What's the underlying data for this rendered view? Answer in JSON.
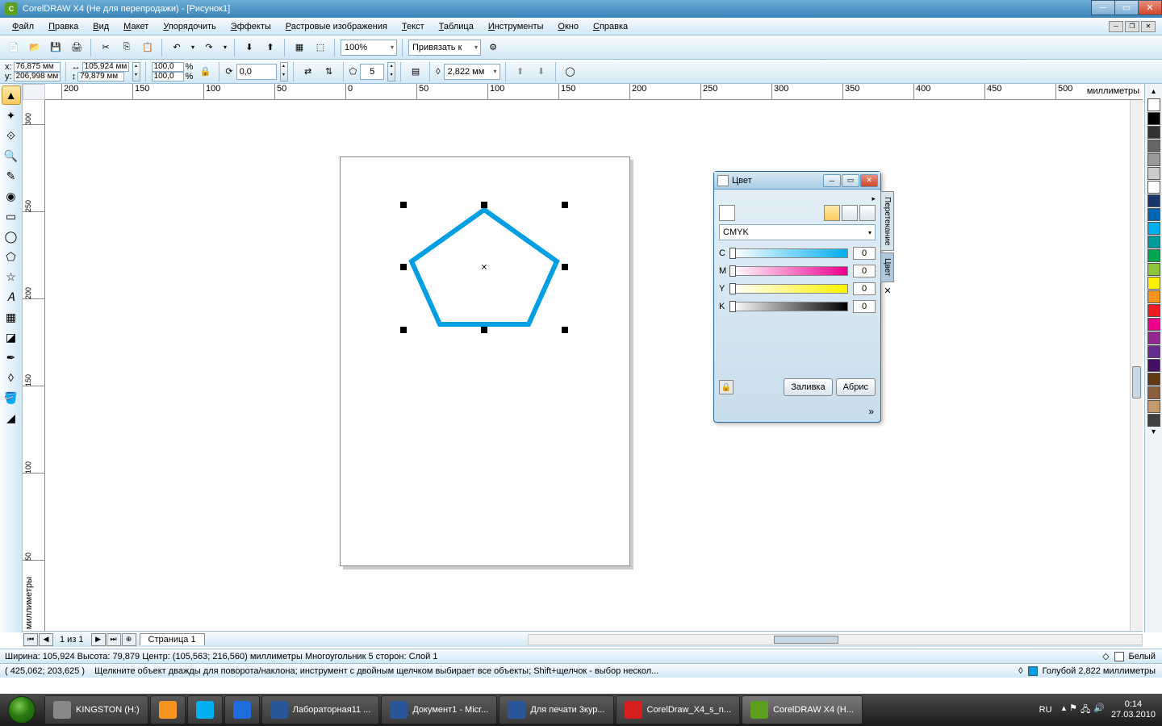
{
  "window": {
    "title": "CorelDRAW X4 (Не для перепродажи) - [Рисунок1]"
  },
  "menu": [
    "Файл",
    "Правка",
    "Вид",
    "Макет",
    "Упорядочить",
    "Эффекты",
    "Растровые изображения",
    "Текст",
    "Таблица",
    "Инструменты",
    "Окно",
    "Справка"
  ],
  "toolbar1": {
    "zoom": "100%",
    "snap_label": "Привязать к"
  },
  "propbar": {
    "x_label": "x:",
    "x": "76,875 мм",
    "y_label": "y:",
    "y": "206,998 мм",
    "w": "105,924 мм",
    "h": "79,879 мм",
    "sx": "100,0",
    "sy": "100,0",
    "pct": "%",
    "rot": "0,0",
    "deg": "o",
    "sides": "5",
    "outline": "2,822 мм"
  },
  "ruler_h": [
    "200",
    "150",
    "100",
    "50",
    "0",
    "50",
    "100",
    "150",
    "200",
    "250",
    "300",
    "350",
    "400",
    "450",
    "500"
  ],
  "ruler_h_unit": "миллиметры",
  "ruler_v": [
    "300",
    "250",
    "200",
    "150",
    "100",
    "50"
  ],
  "ruler_v_unit": "миллиметры",
  "docker": {
    "title": "Цвет",
    "model": "CMYK",
    "channels": [
      {
        "l": "C",
        "v": "0",
        "grad": "linear-gradient(90deg,#fff,#00aeef)"
      },
      {
        "l": "M",
        "v": "0",
        "grad": "linear-gradient(90deg,#fff,#ec008c)"
      },
      {
        "l": "Y",
        "v": "0",
        "grad": "linear-gradient(90deg,#fff,#fff200)"
      },
      {
        "l": "K",
        "v": "0",
        "grad": "linear-gradient(90deg,#fff,#000)"
      }
    ],
    "fill_btn": "Заливка",
    "outline_btn": "Абрис",
    "tab1": "Перетекание",
    "tab2": "Цвет"
  },
  "palette": [
    "none",
    "#000",
    "#333",
    "#666",
    "#999",
    "#ccc",
    "#fff",
    "#1a3668",
    "#0066b3",
    "#00aeef",
    "#009a9a",
    "#00a651",
    "#8dc63e",
    "#fff200",
    "#f7941d",
    "#ed1c24",
    "#ec008c",
    "#92278f",
    "#662d91",
    "#440e62",
    "#603913",
    "#8b5e3c",
    "#c49a6c",
    "#404040"
  ],
  "page_nav": {
    "info": "1 из 1",
    "tab": "Страница 1"
  },
  "status1": {
    "text": "Ширина: 105,924 Высота: 79,879 Центр: (105,563; 216,560) миллиметры      Многоугольник 5 сторон: Слой 1",
    "fill_label": "Белый"
  },
  "status2": {
    "coords": "( 425,062; 203,625 )",
    "hint": "Щелкните объект дважды для поворота/наклона; инструмент с двойным щелчком выбирает все объекты; Shift+щелчок - выбор нескол...",
    "outline_label": "Голубой 2,822 миллиметры"
  },
  "taskbar": {
    "items": [
      {
        "label": "KINGSTON (H:)",
        "color": "#888"
      },
      {
        "label": "",
        "color": "#f79420",
        "quick": true
      },
      {
        "label": "",
        "color": "#00aff0",
        "quick": true
      },
      {
        "label": "",
        "color": "#1e6cde",
        "quick": true
      },
      {
        "label": "Лабораторная11 ...",
        "color": "#2b579a"
      },
      {
        "label": "Документ1 - Micr...",
        "color": "#2b579a"
      },
      {
        "label": "Для печати 3кур...",
        "color": "#2b579a"
      },
      {
        "label": "CorelDraw_X4_s_n...",
        "color": "#d6201e"
      },
      {
        "label": "CorelDRAW X4 (Н...",
        "color": "#5c9e1e",
        "active": true
      }
    ],
    "lang": "RU",
    "time": "0:14",
    "date": "27.03.2010"
  }
}
